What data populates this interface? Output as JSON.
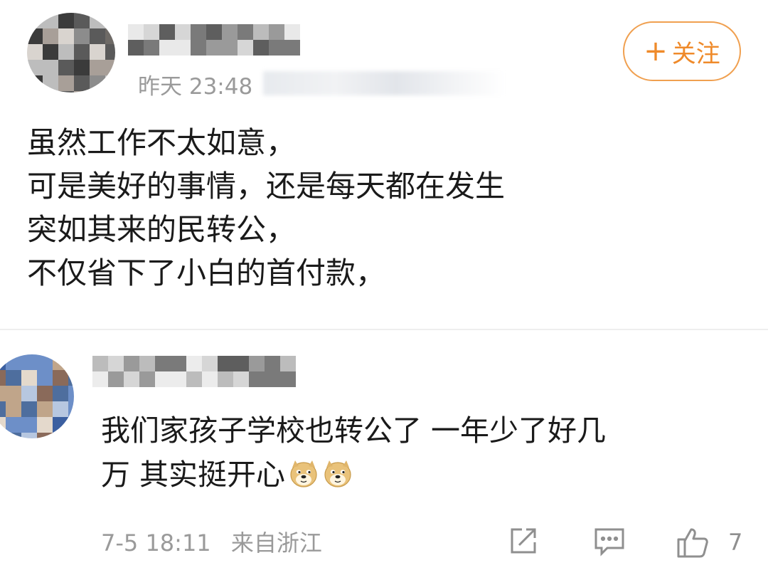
{
  "post": {
    "timestamp": "昨天 23:48",
    "follow_label": "关注",
    "follow_icon": "plus-icon",
    "body_lines": [
      "虽然工作不太如意，",
      "可是美好的事情，还是每天都在发生",
      "突如其来的民转公，",
      "不仅省下了小白的首付款，"
    ]
  },
  "comment": {
    "body_lines": [
      "我们家孩子学校也转公了  一年少了好几",
      "万  其实挺开心"
    ],
    "emoji": [
      "doge-emoji",
      "doge-emoji"
    ],
    "date": "7-5 18:11",
    "source": "来自浙江",
    "actions": {
      "share_icon": "share-icon",
      "comment_icon": "comment-icon",
      "like_icon": "thumbs-up-icon",
      "like_count": "7"
    }
  },
  "colors": {
    "accent": "#ef8a2a",
    "muted_text": "#9a9a9a",
    "body_text": "#1a1a1a"
  }
}
